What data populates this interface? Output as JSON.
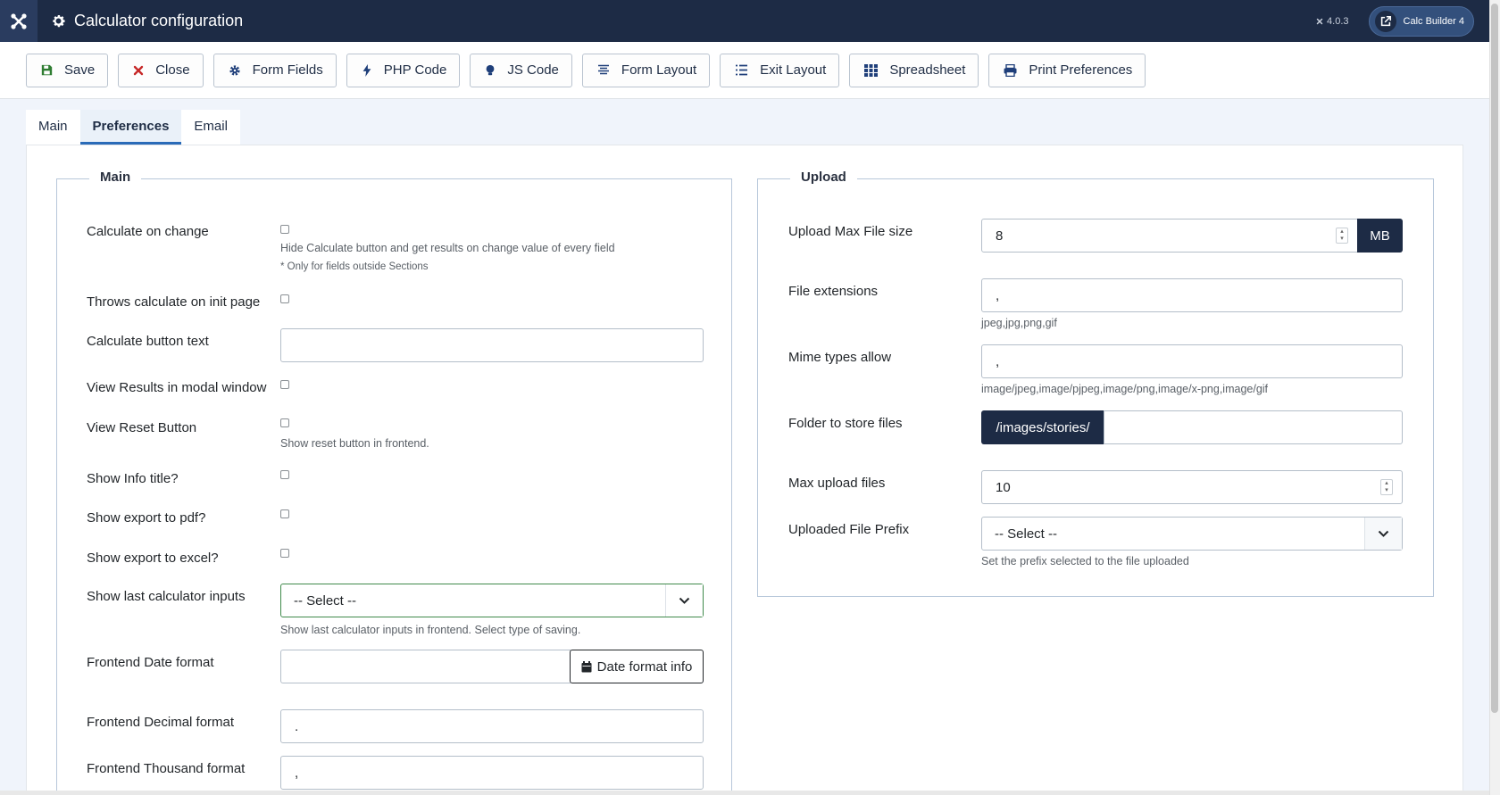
{
  "header": {
    "title": "Calculator configuration",
    "version": "4.0.3",
    "external_button": "Calc Builder 4",
    "colors": {
      "header_bg": "#1d2b45",
      "accent": "#2a6bb8"
    }
  },
  "toolbar": {
    "save": "Save",
    "close": "Close",
    "form_fields": "Form Fields",
    "php_code": "PHP Code",
    "js_code": "JS Code",
    "form_layout": "Form Layout",
    "exit_layout": "Exit Layout",
    "spreadsheet": "Spreadsheet",
    "print_preferences": "Print Preferences"
  },
  "tabs": [
    {
      "label": "Main",
      "active": false
    },
    {
      "label": "Preferences",
      "active": true
    },
    {
      "label": "Email",
      "active": false
    }
  ],
  "main_section": {
    "legend": "Main",
    "calculate_on_change": {
      "label": "Calculate on change",
      "help": "Hide Calculate button and get results on change value of every field",
      "note": "* Only for fields outside Sections",
      "checked": false
    },
    "throws_calculate": {
      "label": "Throws calculate on init page",
      "checked": false
    },
    "calculate_button_text": {
      "label": "Calculate button text",
      "value": ""
    },
    "view_results_modal": {
      "label": "View Results in modal window",
      "checked": false
    },
    "view_reset_button": {
      "label": "View Reset Button",
      "help": "Show reset button in frontend.",
      "checked": false
    },
    "show_info_title": {
      "label": "Show Info title?",
      "checked": false
    },
    "show_export_pdf": {
      "label": "Show export to pdf?",
      "checked": false
    },
    "show_export_excel": {
      "label": "Show export to excel?",
      "checked": false
    },
    "show_last_inputs": {
      "label": "Show last calculator inputs",
      "selected": "-- Select --",
      "help": "Show last calculator inputs in frontend. Select type of saving."
    },
    "frontend_date_format": {
      "label": "Frontend Date format",
      "value": "",
      "button": "Date format info"
    },
    "frontend_decimal_format": {
      "label": "Frontend Decimal format",
      "value": "."
    },
    "frontend_thousand_format": {
      "label": "Frontend Thousand format",
      "value": ","
    }
  },
  "upload_section": {
    "legend": "Upload",
    "max_file_size": {
      "label": "Upload Max File size",
      "value": "8",
      "unit": "MB"
    },
    "file_extensions": {
      "label": "File extensions",
      "value": ",",
      "help": "jpeg,jpg,png,gif"
    },
    "mime_types": {
      "label": "Mime types allow",
      "value": ",",
      "help": "image/jpeg,image/pjpeg,image/png,image/x-png,image/gif"
    },
    "folder": {
      "label": "Folder to store files",
      "prefix": "/images/stories/",
      "value": ""
    },
    "max_upload_files": {
      "label": "Max upload files",
      "value": "10"
    },
    "file_prefix": {
      "label": "Uploaded File Prefix",
      "selected": "-- Select --",
      "help": "Set the prefix selected to the file uploaded"
    }
  }
}
